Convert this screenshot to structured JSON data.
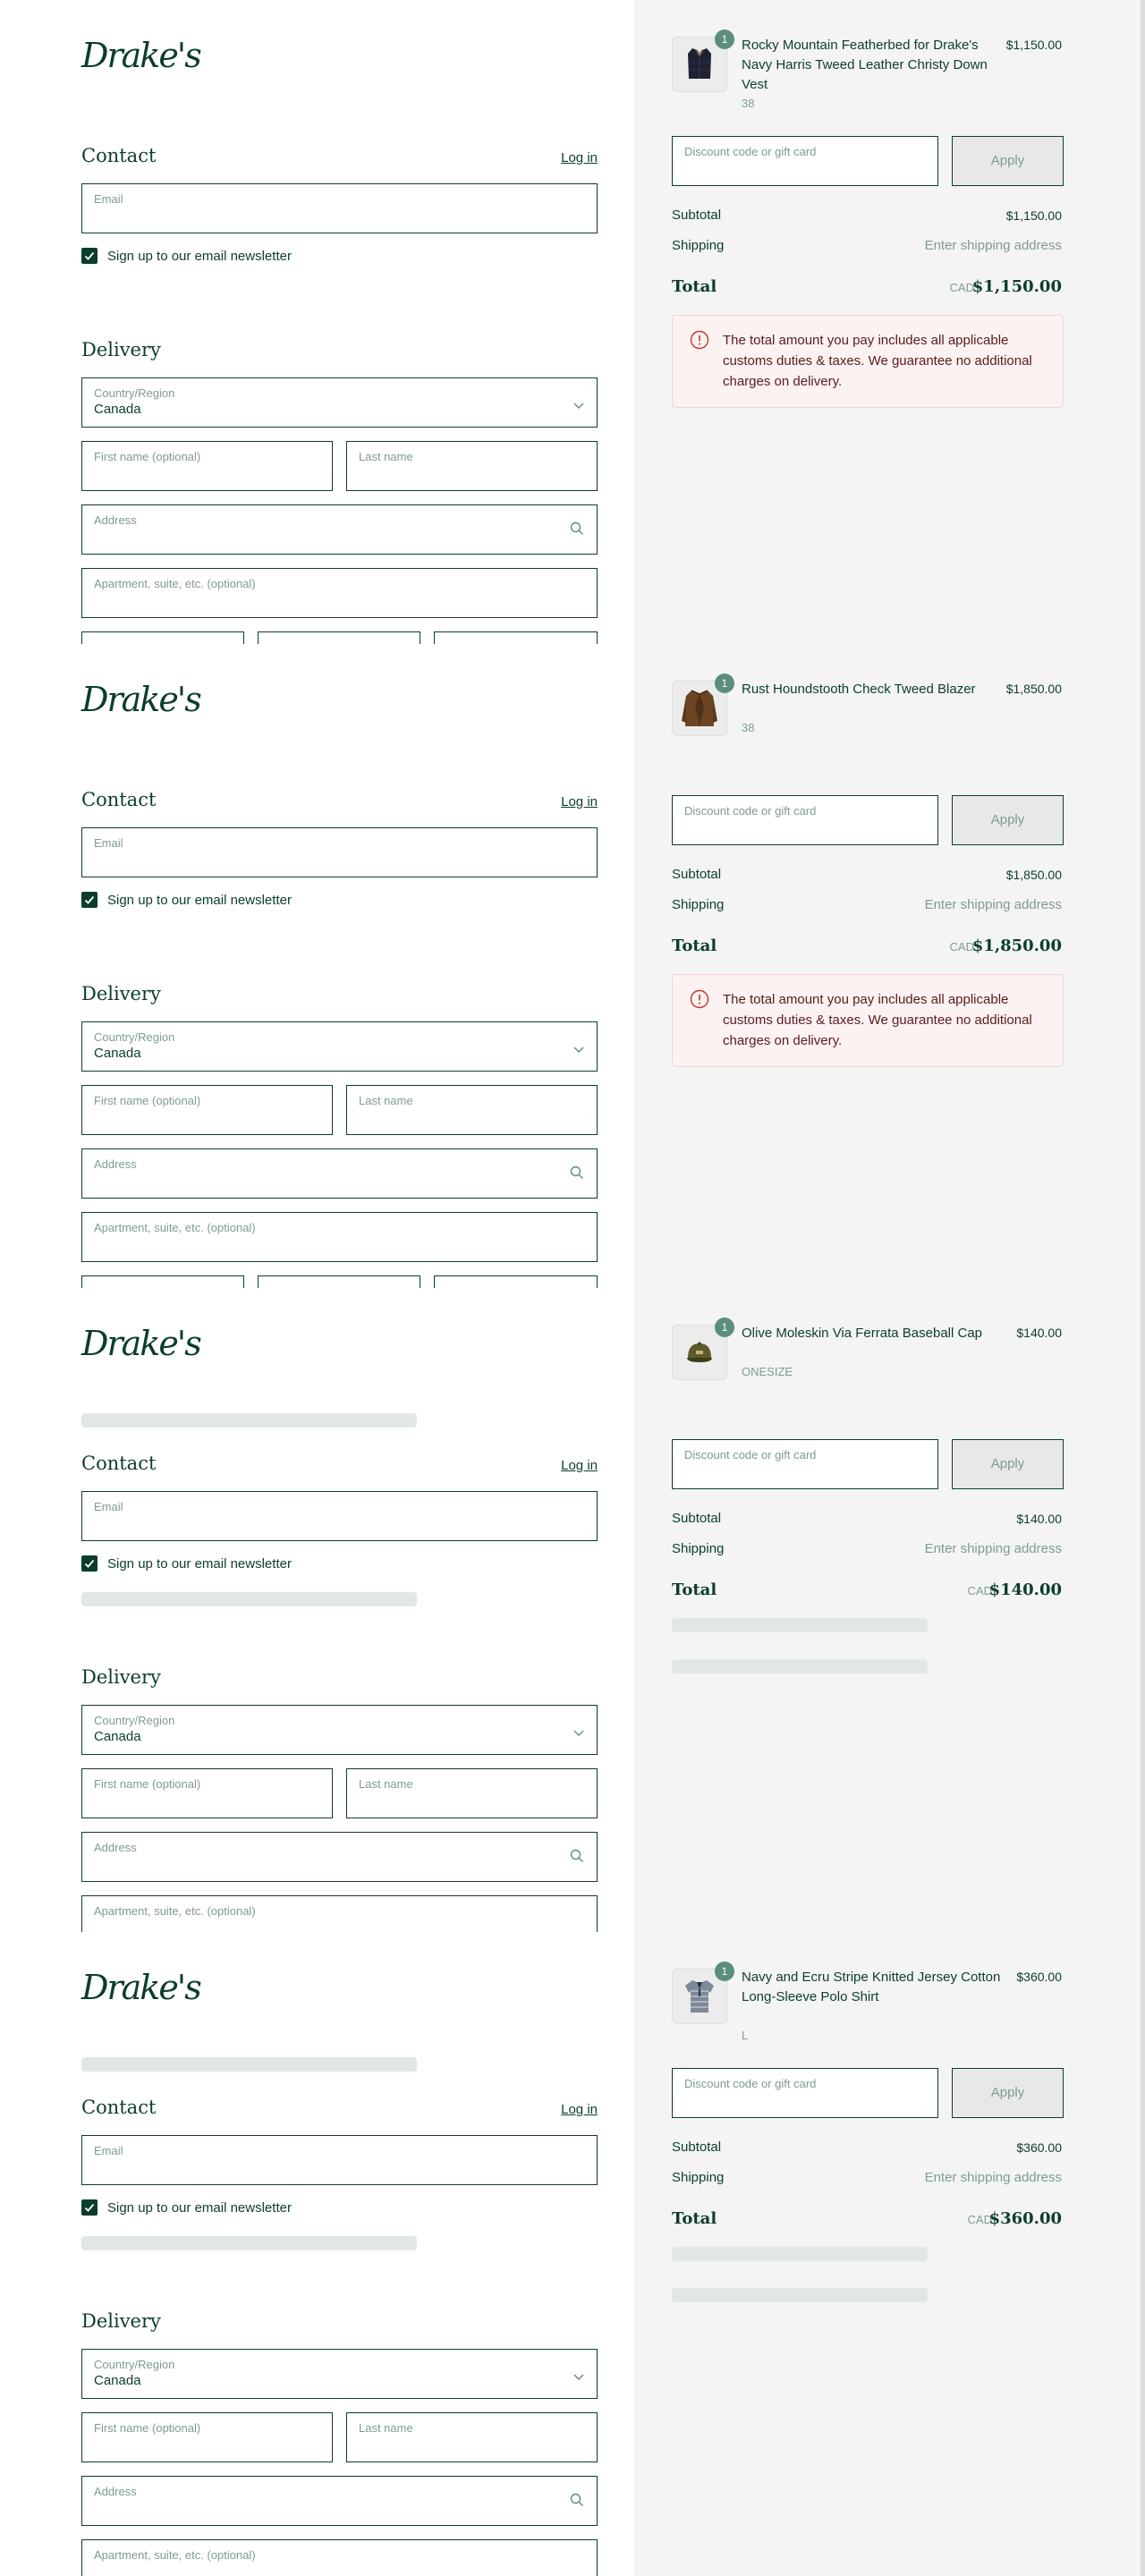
{
  "brand": {
    "logo_text": "Drake's"
  },
  "colors": {
    "brand_green": "#0b3d2e",
    "muted_green": "#7f9b8f",
    "badge_green": "#5b8e7d",
    "summary_bg": "#f4f4f4",
    "notice_bg": "#fdf2f2",
    "notice_text": "#5a1b1b",
    "notice_icon": "#c0392b",
    "skeleton": "#e1e8e4"
  },
  "contact": {
    "title": "Contact",
    "login_label": "Log in",
    "email_placeholder": "Email",
    "newsletter_label": "Sign up to our email newsletter",
    "newsletter_checked": true
  },
  "delivery": {
    "title": "Delivery",
    "country_label": "Country/Region",
    "country_value": "Canada",
    "first_name_placeholder": "First name (optional)",
    "last_name_placeholder": "Last name",
    "address_placeholder": "Address",
    "apartment_placeholder": "Apartment, suite, etc. (optional)"
  },
  "summary": {
    "discount_placeholder": "Discount code or gift card",
    "apply_label": "Apply",
    "subtotal_label": "Subtotal",
    "shipping_label": "Shipping",
    "shipping_value": "Enter shipping address",
    "total_label": "Total",
    "currency": "CAD",
    "notice_text": "The total amount you pay includes all applicable customs duties & taxes. We guarantee no additional charges on delivery."
  },
  "orders": [
    {
      "product_name": "Rocky Mountain Featherbed for Drake's Navy Harris Tweed Leather Christy Down Vest",
      "variant": "38",
      "quantity": "1",
      "price": "$1,150.00",
      "subtotal": "$1,150.00",
      "total": "$1,150.00",
      "show_notice": true,
      "loading": false,
      "image_icon": "vest-icon"
    },
    {
      "product_name": "Rust Houndstooth Check Tweed Blazer",
      "variant": "38",
      "quantity": "1",
      "price": "$1,850.00",
      "subtotal": "$1,850.00",
      "total": "$1,850.00",
      "show_notice": true,
      "loading": false,
      "image_icon": "blazer-icon"
    },
    {
      "product_name": "Olive Moleskin Via Ferrata Baseball Cap",
      "variant": "ONESIZE",
      "quantity": "1",
      "price": "$140.00",
      "subtotal": "$140.00",
      "total": "$140.00",
      "show_notice": false,
      "loading": true,
      "image_icon": "cap-icon"
    },
    {
      "product_name": "Navy and Ecru Stripe Knitted Jersey Cotton Long-Sleeve Polo Shirt",
      "variant": "L",
      "quantity": "1",
      "price": "$360.00",
      "subtotal": "$360.00",
      "total": "$360.00",
      "show_notice": false,
      "loading": true,
      "image_icon": "polo-shirt-icon"
    }
  ]
}
